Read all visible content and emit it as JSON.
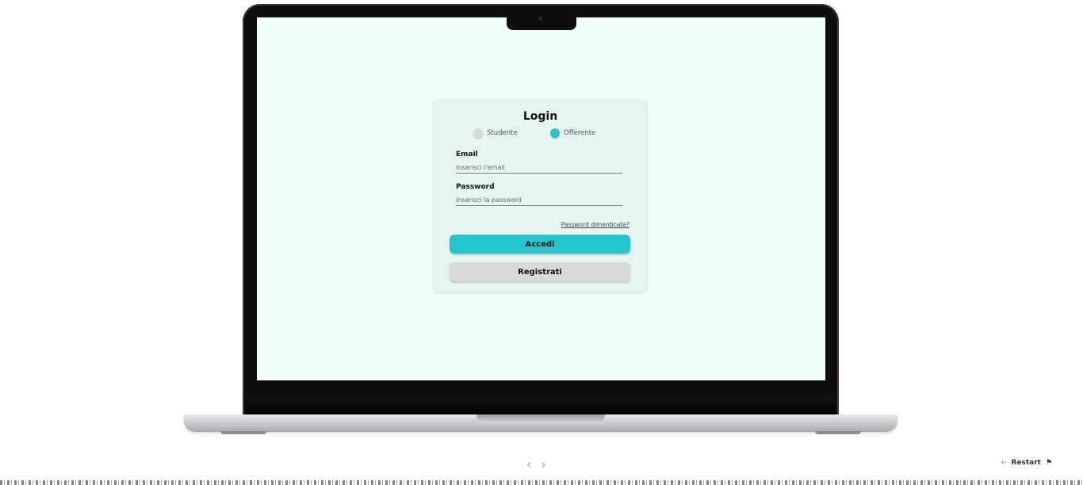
{
  "login": {
    "title": "Login",
    "roles": [
      {
        "label": "Studente",
        "selected": false
      },
      {
        "label": "Offerente",
        "selected": true
      }
    ],
    "email": {
      "label": "Email",
      "placeholder": "Inserisci l'email",
      "value": ""
    },
    "password": {
      "label": "Password",
      "placeholder": "Inserisci la password",
      "value": ""
    },
    "forgot_label": "Password dimenticata?",
    "login_button": "Accedi",
    "register_button": "Registrati"
  },
  "viewer": {
    "prev_icon": "chevron-left-icon",
    "next_icon": "chevron-right-icon",
    "restart_label": "Restart",
    "prev_arrow": "‹",
    "next_arrow": "›"
  },
  "colors": {
    "accent": "#27c6cf",
    "screen_bg": "#f1fffa",
    "card_bg": "#e6f5f0",
    "secondary_button": "#d9d9d9"
  }
}
